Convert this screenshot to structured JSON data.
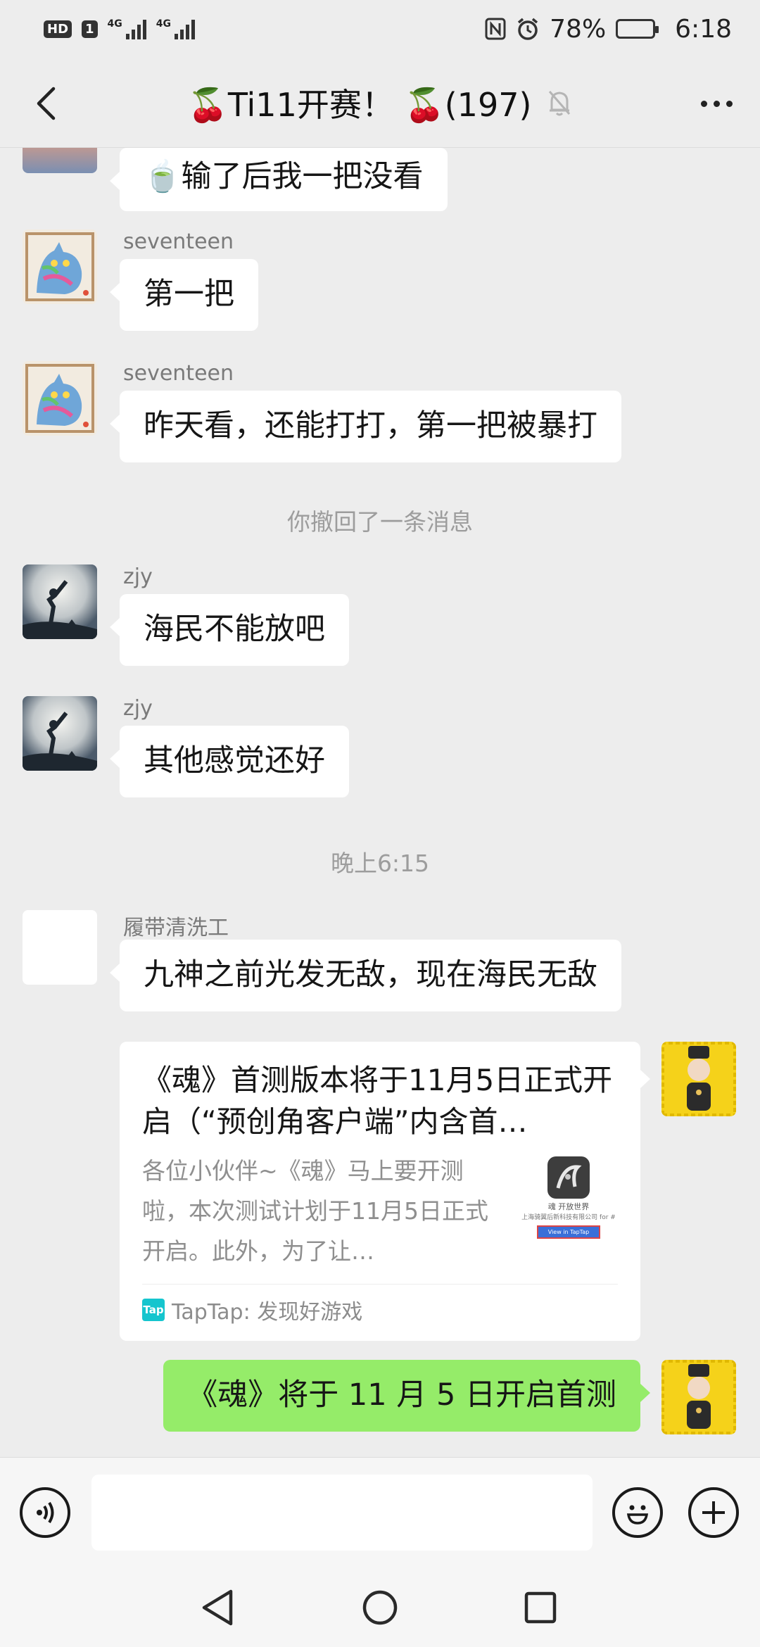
{
  "status_bar": {
    "hd": "HD",
    "sim1": "1",
    "net1": "4G",
    "net2": "4G",
    "battery_pct": "78%",
    "battery_level": 0.78,
    "time": "6:18"
  },
  "header": {
    "title": "🍒Ti11开赛！ 🍒(197)",
    "muted_icon": "bell-off-icon",
    "back_icon": "chevron-left-icon",
    "more_icon": "more-dots-icon"
  },
  "messages": {
    "m0": {
      "text": "🍵输了后我一把没看"
    },
    "m1": {
      "sender": "seventeen",
      "text": "第一把"
    },
    "m2": {
      "sender": "seventeen",
      "text": "昨天看，还能打打，第一把被暴打"
    },
    "recall": "你撤回了一条消息",
    "m3": {
      "sender": "zjy",
      "text": "海民不能放吧"
    },
    "m4": {
      "sender": "zjy",
      "text": "其他感觉还好"
    },
    "time_divider": "晚上6:15",
    "m5": {
      "sender": "履带清洗工",
      "text": "九神之前光发无敌，现在海民无敌"
    },
    "card": {
      "title": "《魂》首测版本将于11月5日正式开启（“预创角客户端”内含首…",
      "desc": "各位小伙伴~《魂》马上要开测啦，本次测试计划于11月5日正式开启。此外，为了让…",
      "thumb_caption": "魂 开放世界",
      "thumb_sub": "上海骑翼后新科技有限公司 for #",
      "thumb_button": "View in TapTap",
      "source_logo": "Tap",
      "source": "TapTap: 发现好游戏"
    },
    "m6": {
      "text": "《魂》将于 11 月 5 日开启首测"
    }
  },
  "input_bar": {
    "voice_icon": "voice-icon",
    "emoji_icon": "emoji-icon",
    "plus_icon": "plus-icon",
    "value": ""
  },
  "nav_bar": {
    "back_icon": "nav-back-icon",
    "home_icon": "nav-home-icon",
    "recents_icon": "nav-recents-icon"
  }
}
